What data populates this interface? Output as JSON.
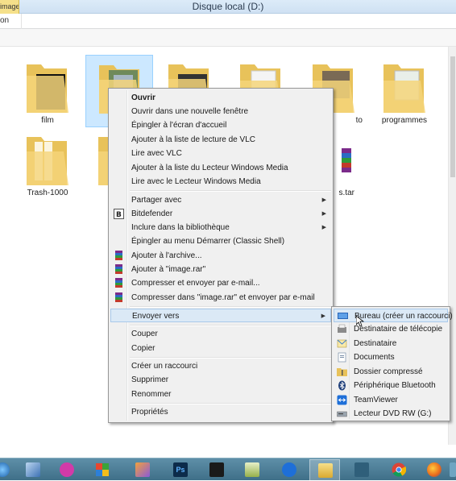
{
  "window": {
    "title": "Disque local (D:)",
    "tab_fragment": "image",
    "ribbon_fragment": "on"
  },
  "folders": [
    {
      "label": "film"
    },
    {
      "label": ""
    },
    {
      "label": ""
    },
    {
      "label": ""
    },
    {
      "label": "to"
    },
    {
      "label": "programmes"
    },
    {
      "label": "Trash-1000"
    },
    {
      "label": ""
    },
    {
      "label": "s.tar"
    }
  ],
  "context_menu": {
    "items": [
      {
        "label": "Ouvrir",
        "icon": "",
        "bold": true
      },
      {
        "label": "Ouvrir dans une nouvelle fenêtre",
        "icon": ""
      },
      {
        "label": "Épingler à l'écran d'accueil",
        "icon": ""
      },
      {
        "label": "Ajouter à la liste de lecture de VLC",
        "icon": ""
      },
      {
        "label": "Lire avec VLC",
        "icon": ""
      },
      {
        "label": "Ajouter à la liste du Lecteur Windows Media",
        "icon": ""
      },
      {
        "label": "Lire avec le Lecteur Windows Media",
        "icon": ""
      },
      {
        "label": "Partager avec",
        "icon": "",
        "submenu": true
      },
      {
        "label": "Bitdefender",
        "icon": "bitdefender-icon",
        "submenu": true
      },
      {
        "label": "Inclure dans la bibliothèque",
        "icon": "",
        "submenu": true
      },
      {
        "label": "Épingler au menu Démarrer (Classic Shell)",
        "icon": ""
      },
      {
        "label": "Ajouter à l'archive...",
        "icon": "winrar-icon"
      },
      {
        "label": "Ajouter à \"image.rar\"",
        "icon": "winrar-icon"
      },
      {
        "label": "Compresser et envoyer par e-mail...",
        "icon": "winrar-icon"
      },
      {
        "label": "Compresser dans \"image.rar\" et envoyer par e-mail",
        "icon": "winrar-icon"
      },
      {
        "label": "Envoyer vers",
        "icon": "",
        "submenu": true,
        "hover": true
      },
      {
        "label": "Couper",
        "icon": ""
      },
      {
        "label": "Copier",
        "icon": ""
      },
      {
        "label": "Créer un raccourci",
        "icon": ""
      },
      {
        "label": "Supprimer",
        "icon": ""
      },
      {
        "label": "Renommer",
        "icon": ""
      },
      {
        "label": "Propriétés",
        "icon": ""
      }
    ]
  },
  "send_to_menu": {
    "items": [
      {
        "label": "Bureau (créer un raccourci)",
        "icon": "desktop-icon",
        "hover": true
      },
      {
        "label": "Destinataire de télécopie",
        "icon": "fax-icon"
      },
      {
        "label": "Destinataire",
        "icon": "mail-icon"
      },
      {
        "label": "Documents",
        "icon": "documents-icon"
      },
      {
        "label": "Dossier compressé",
        "icon": "zip-folder-icon"
      },
      {
        "label": "Périphérique Bluetooth",
        "icon": "bluetooth-icon"
      },
      {
        "label": "TeamViewer",
        "icon": "teamviewer-icon"
      },
      {
        "label": "Lecteur DVD RW (G:)",
        "icon": "dvd-drive-icon"
      }
    ]
  },
  "colors": {
    "accent": "#3399ff",
    "menu_bg": "#f0f0f0",
    "hover": "#dbe9f6",
    "taskbar": "#4f7f98"
  },
  "taskbar": {
    "apps": [
      {
        "name": "start-orb"
      },
      {
        "name": "virtualbox"
      },
      {
        "name": "app-magenta"
      },
      {
        "name": "windows-flag"
      },
      {
        "name": "paint"
      },
      {
        "name": "photoshop"
      },
      {
        "name": "3dsmax"
      },
      {
        "name": "editor"
      },
      {
        "name": "teamviewer"
      },
      {
        "name": "explorer",
        "active": true
      },
      {
        "name": "network"
      },
      {
        "name": "chrome"
      },
      {
        "name": "firefox"
      },
      {
        "name": "overflow"
      }
    ]
  }
}
